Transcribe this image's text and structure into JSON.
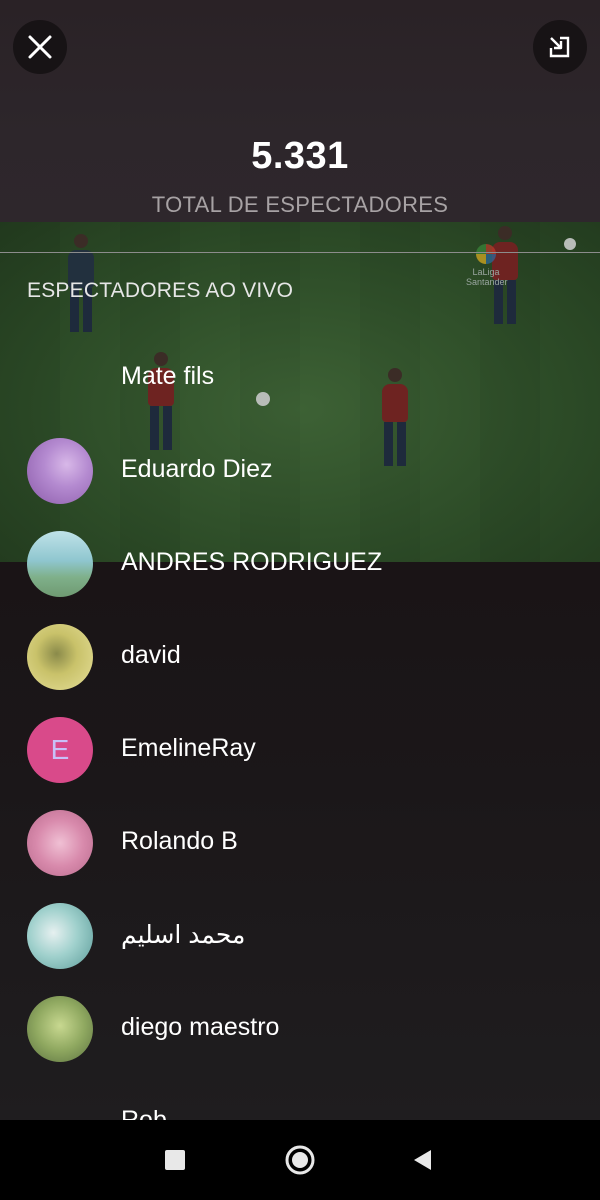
{
  "stats": {
    "total_count": "5.331",
    "total_label": "TOTAL DE ESPECTADORES"
  },
  "section": {
    "header": "ESPECTADORES AO VIVO"
  },
  "viewers": [
    {
      "name": "Mate fils",
      "avatar": "none"
    },
    {
      "name": "Eduardo Diez",
      "avatar": "photo-purple"
    },
    {
      "name": "ANDRES RODRIGUEZ",
      "avatar": "photo-landscape-teal"
    },
    {
      "name": "david",
      "avatar": "photo-yellow-person"
    },
    {
      "name": "EmelineRay",
      "avatar": "letter",
      "letter": "E",
      "color": "#d94a8a"
    },
    {
      "name": "Rolando B",
      "avatar": "photo-pink"
    },
    {
      "name": "محمد اسليم",
      "avatar": "photo-teal-pattern"
    },
    {
      "name": "diego maestro",
      "avatar": "photo-cartoon-green"
    },
    {
      "name": "Rob...",
      "avatar": "none"
    }
  ],
  "icons": {
    "close": "close-icon",
    "minimize": "minimize-icon",
    "nav_recents": "square-icon",
    "nav_home": "circle-icon",
    "nav_back": "triangle-back-icon"
  },
  "colors": {
    "accent_letter_avatar": "#d94a8a",
    "background_dark": "#151214",
    "muted_text": "#a7a2a4"
  }
}
